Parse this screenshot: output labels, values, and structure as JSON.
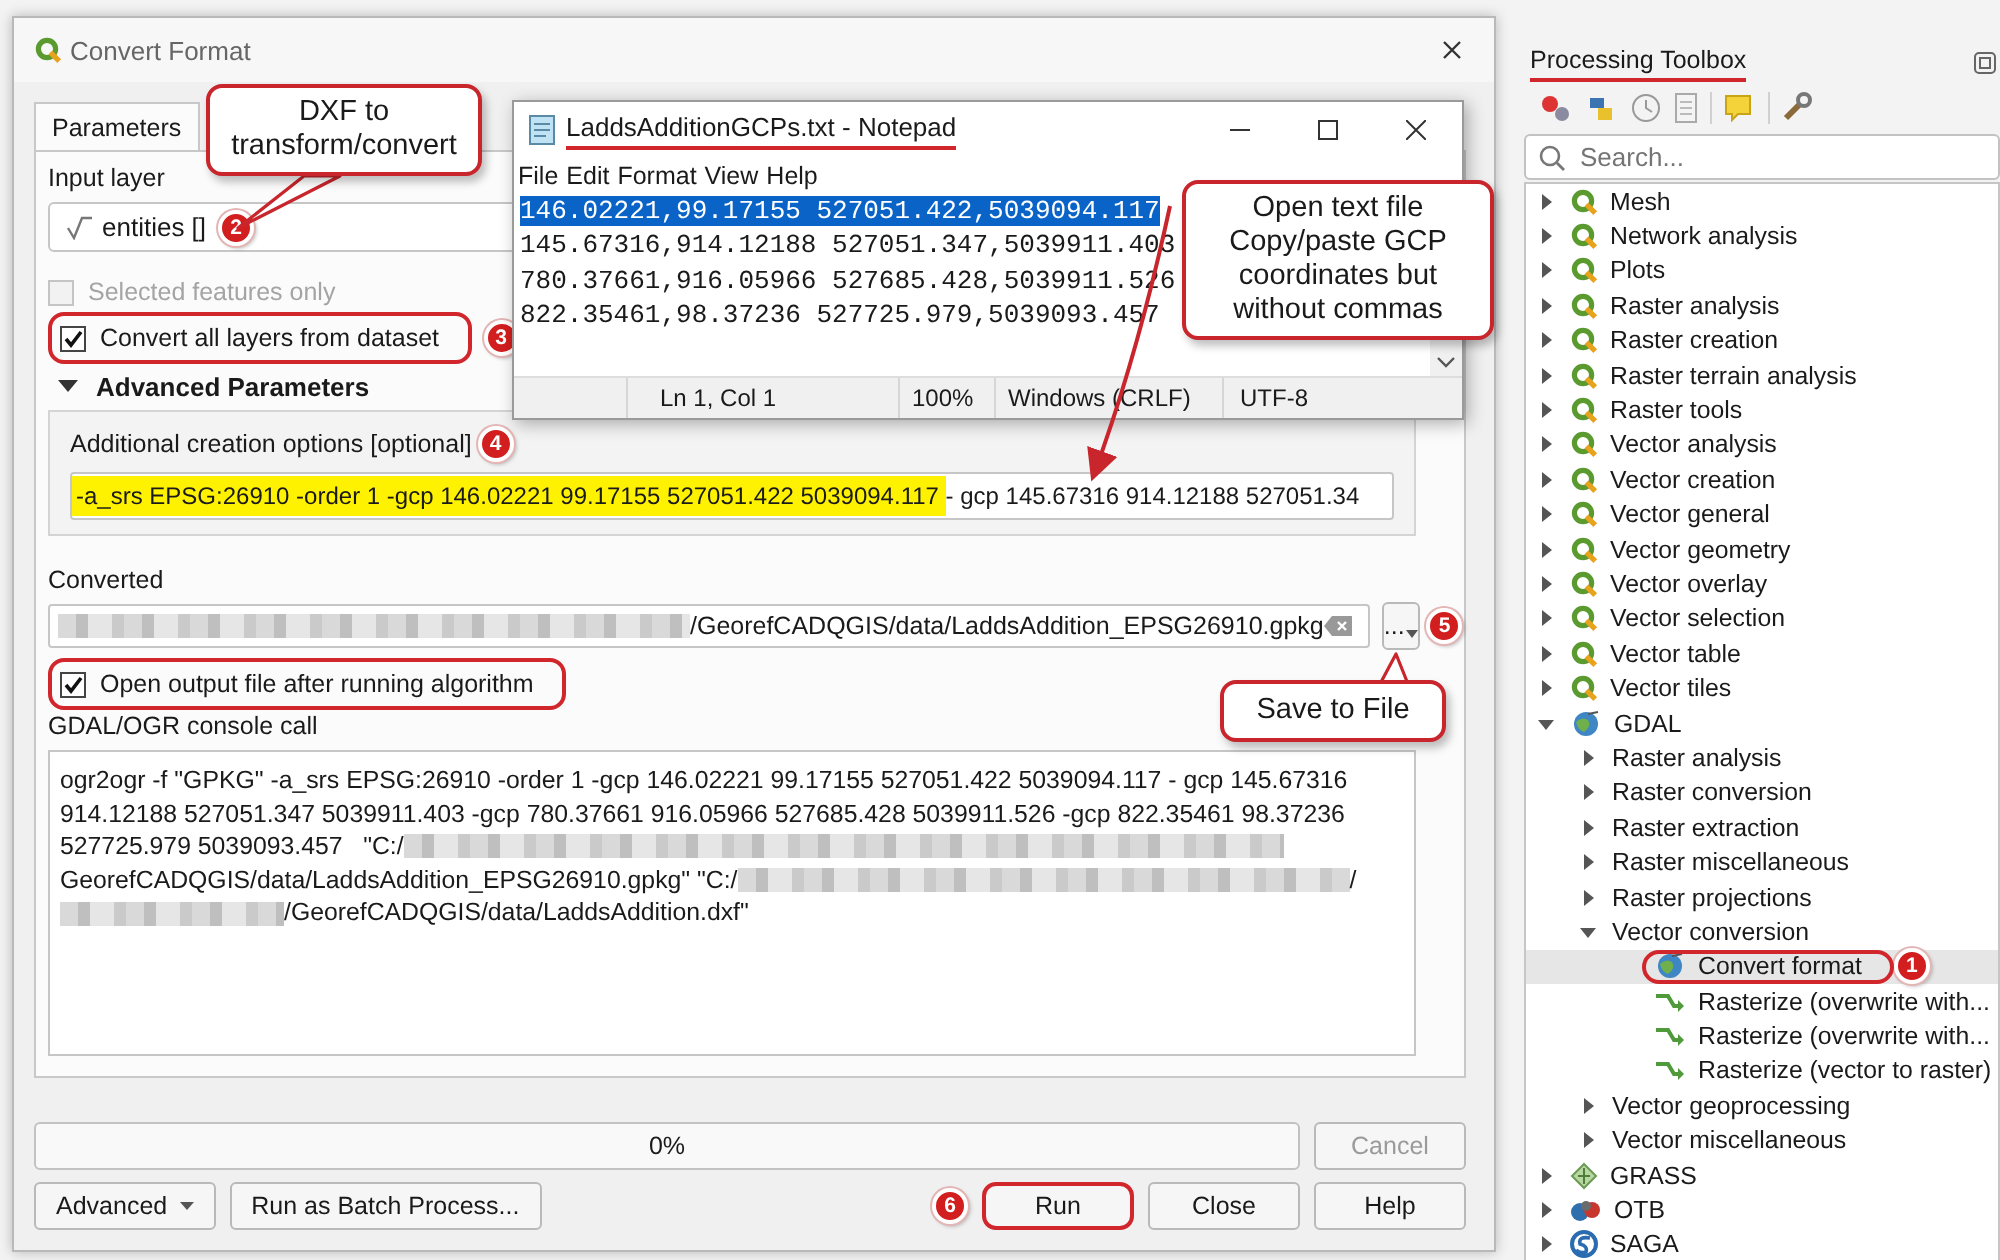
{
  "dialog": {
    "title": "Convert Format",
    "tabs": [
      {
        "label": "Parameters",
        "selected": true
      }
    ],
    "input_layer": {
      "label": "Input layer",
      "value": "entities []",
      "badge": "2",
      "callout": "DXF to transform/convert"
    },
    "options": [
      {
        "label": "Selected features only",
        "checked": false,
        "disabled": true,
        "outlined": false
      },
      {
        "label": "Convert all layers from dataset",
        "checked": true,
        "disabled": false,
        "outlined": true,
        "badge": "3"
      }
    ],
    "advanced": {
      "label": "Advanced Parameters",
      "expanded": true
    },
    "creation_options": {
      "label": "Additional creation options [optional]",
      "badge": "4",
      "value": [
        {
          "text": "-a_srs EPSG:26910 -order 1 -gcp 146.02221 99.17155 527051.422 5039094.117 ",
          "highlighted": true
        },
        {
          "text": "- gcp 145.67316 914.12188 527051.34",
          "highlighted": false
        }
      ]
    },
    "output": {
      "label": "Converted",
      "value": [
        {
          "kind": "redacted"
        },
        {
          "kind": "text",
          "text": "/GeorefCADQGIS/data/LaddsAddition_EPSG26910.gpkg"
        }
      ],
      "browse_label": "...",
      "badge": "5",
      "callout": "Save to File"
    },
    "open_output": {
      "label": "Open output file after running algorithm",
      "checked": true,
      "outlined": true
    },
    "console": {
      "label": "GDAL/OGR console call",
      "lines": [
        [
          {
            "kind": "text",
            "text": "ogr2ogr -f \"GPKG\" -a_srs EPSG:26910 -order 1 -gcp 146.02221 99.17155 527051.422 5039094.117 - gcp 145.67316"
          }
        ],
        [
          {
            "kind": "text",
            "text": "914.12188 527051.347 5039911.403 -gcp 780.37661 916.05966 527685.428 5039911.526 -gcp 822.35461 98.37236"
          }
        ],
        [
          {
            "kind": "text",
            "text": "527725.979 5039093.457   \"C:/"
          },
          {
            "kind": "redacted"
          }
        ],
        [
          {
            "kind": "text",
            "text": "GeorefCADQGIS/data/LaddsAddition_EPSG26910.gpkg\" \"C:/"
          },
          {
            "kind": "redacted"
          },
          {
            "kind": "text",
            "text": "/"
          }
        ],
        [
          {
            "kind": "redacted"
          },
          {
            "kind": "text",
            "text": "/GeorefCADQGIS/data/LaddsAddition.dxf\""
          }
        ]
      ]
    },
    "progress": {
      "text": "0%",
      "level": 0
    },
    "cancel": {
      "label": "Cancel",
      "disabled": true
    },
    "buttons_left": [
      {
        "label": "Advanced",
        "dropdown": true,
        "outlined": false
      },
      {
        "label": "Run as Batch Process...",
        "dropdown": false,
        "outlined": false
      }
    ],
    "buttons_right": [
      {
        "label": "Run",
        "dropdown": false,
        "outlined": true,
        "badge": "6"
      },
      {
        "label": "Close",
        "dropdown": false,
        "outlined": false
      },
      {
        "label": "Help",
        "dropdown": false,
        "outlined": false
      }
    ]
  },
  "notepad": {
    "title": "LaddsAdditionGCPs.txt - Notepad",
    "underlined": true,
    "menu": [
      "File",
      "Edit",
      "Format",
      "View",
      "Help"
    ],
    "lines": [
      {
        "text": "146.02221,99.17155 527051.422,5039094.117",
        "selected": true
      },
      {
        "text": "145.67316,914.12188 527051.347,5039911.403",
        "selected": false
      },
      {
        "text": "780.37661,916.05966 527685.428,5039911.526",
        "selected": false
      },
      {
        "text": "822.35461,98.37236 527725.979,5039093.457",
        "selected": false
      }
    ],
    "status": [
      "Ln 1, Col 1",
      "100%",
      "Windows (CRLF)",
      "UTF-8"
    ],
    "callout": "Open text file Copy/paste GCP coordinates but without commas"
  },
  "toolbox": {
    "title": "Processing Toolbox",
    "underlined": true,
    "search": {
      "placeholder": "Search..."
    },
    "tree": [
      {
        "label": "Mesh",
        "kind": "native",
        "expanded": false,
        "selected": false
      },
      {
        "label": "Network analysis",
        "kind": "native",
        "expanded": false,
        "selected": false
      },
      {
        "label": "Plots",
        "kind": "native",
        "expanded": false,
        "selected": false
      },
      {
        "label": "Raster analysis",
        "kind": "native",
        "expanded": false,
        "selected": false
      },
      {
        "label": "Raster creation",
        "kind": "native",
        "expanded": false,
        "selected": false
      },
      {
        "label": "Raster terrain analysis",
        "kind": "native",
        "expanded": false,
        "selected": false
      },
      {
        "label": "Raster tools",
        "kind": "native",
        "expanded": false,
        "selected": false
      },
      {
        "label": "Vector analysis",
        "kind": "native",
        "expanded": false,
        "selected": false
      },
      {
        "label": "Vector creation",
        "kind": "native",
        "expanded": false,
        "selected": false
      },
      {
        "label": "Vector general",
        "kind": "native",
        "expanded": false,
        "selected": false
      },
      {
        "label": "Vector geometry",
        "kind": "native",
        "expanded": false,
        "selected": false
      },
      {
        "label": "Vector overlay",
        "kind": "native",
        "expanded": false,
        "selected": false
      },
      {
        "label": "Vector selection",
        "kind": "native",
        "expanded": false,
        "selected": false
      },
      {
        "label": "Vector table",
        "kind": "native",
        "expanded": false,
        "selected": false
      },
      {
        "label": "Vector tiles",
        "kind": "native",
        "expanded": false,
        "selected": false
      },
      {
        "label": "GDAL",
        "kind": "gdal",
        "expanded": true,
        "selected": false,
        "children": [
          {
            "label": "Raster analysis",
            "expanded": false,
            "selected": false
          },
          {
            "label": "Raster conversion",
            "expanded": false,
            "selected": false
          },
          {
            "label": "Raster extraction",
            "expanded": false,
            "selected": false
          },
          {
            "label": "Raster miscellaneous",
            "expanded": false,
            "selected": false
          },
          {
            "label": "Raster projections",
            "expanded": false,
            "selected": false
          },
          {
            "label": "Vector conversion",
            "expanded": true,
            "selected": false,
            "children": [
              {
                "label": "Convert format",
                "kind": "gdal",
                "selected": true,
                "outlined": true,
                "badge": "1"
              },
              {
                "label": "Rasterize (overwrite with...",
                "kind": "tool",
                "selected": false
              },
              {
                "label": "Rasterize (overwrite with...",
                "kind": "tool",
                "selected": false
              },
              {
                "label": "Rasterize (vector to raster)",
                "kind": "tool",
                "selected": false
              }
            ]
          },
          {
            "label": "Vector geoprocessing",
            "expanded": false,
            "selected": false
          },
          {
            "label": "Vector miscellaneous",
            "expanded": false,
            "selected": false
          }
        ]
      },
      {
        "label": "GRASS",
        "kind": "grass",
        "expanded": false,
        "selected": false
      },
      {
        "label": "OTB",
        "kind": "otb",
        "expanded": false,
        "selected": false
      },
      {
        "label": "SAGA",
        "kind": "saga",
        "expanded": false,
        "selected": false
      }
    ]
  }
}
